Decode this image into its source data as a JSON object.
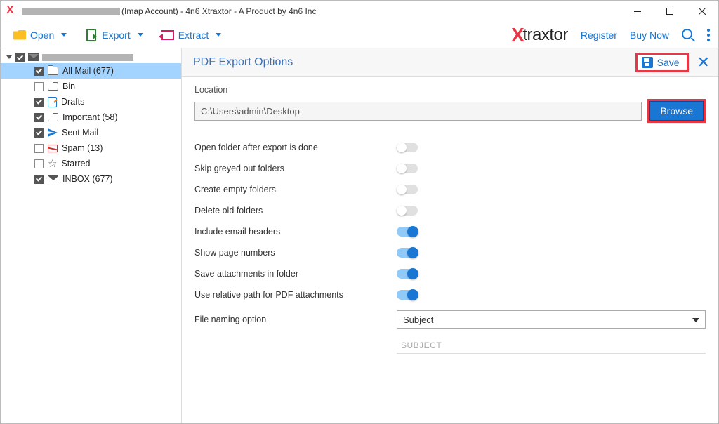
{
  "titlebar": {
    "suffix": "(Imap Account) - 4n6 Xtraxtor - A Product by 4n6 Inc"
  },
  "toolbar": {
    "open": "Open",
    "export": "Export",
    "extract": "Extract",
    "register": "Register",
    "buynow": "Buy Now",
    "brand": "traxtor"
  },
  "sidebar": {
    "items": [
      {
        "label": "All Mail",
        "count": "(677)",
        "checked": true,
        "icon": "folder",
        "selected": true
      },
      {
        "label": "Bin",
        "count": "",
        "checked": false,
        "icon": "folder"
      },
      {
        "label": "Drafts",
        "count": "",
        "checked": true,
        "icon": "draft"
      },
      {
        "label": "Important",
        "count": "(58)",
        "checked": true,
        "icon": "folder"
      },
      {
        "label": "Sent Mail",
        "count": "",
        "checked": true,
        "icon": "sent"
      },
      {
        "label": "Spam",
        "count": "(13)",
        "checked": false,
        "icon": "spam"
      },
      {
        "label": "Starred",
        "count": "",
        "checked": false,
        "icon": "star"
      },
      {
        "label": "INBOX",
        "count": "(677)",
        "checked": true,
        "icon": "mail"
      }
    ]
  },
  "panel": {
    "title": "PDF Export Options",
    "save": "Save",
    "location_label": "Location",
    "location_value": "C:\\Users\\admin\\Desktop",
    "browse": "Browse",
    "options": [
      {
        "label": "Open folder after export is done",
        "on": false
      },
      {
        "label": "Skip greyed out folders",
        "on": false
      },
      {
        "label": "Create empty folders",
        "on": false
      },
      {
        "label": "Delete old folders",
        "on": false
      },
      {
        "label": "Include email headers",
        "on": true
      },
      {
        "label": "Show page numbers",
        "on": true
      },
      {
        "label": "Save attachments in folder",
        "on": true
      },
      {
        "label": "Use relative path for PDF attachments",
        "on": true
      }
    ],
    "naming_label": "File naming option",
    "naming_value": "Subject",
    "preview": "SUBJECT"
  }
}
